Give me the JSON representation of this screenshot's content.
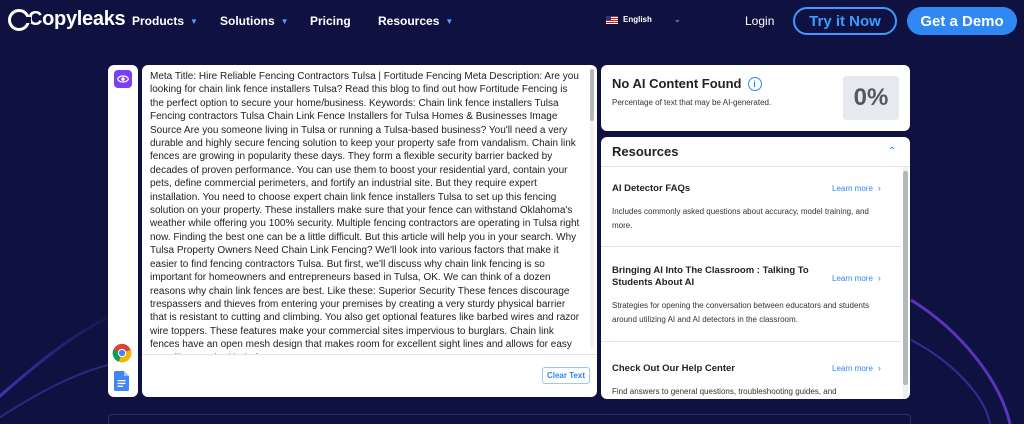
{
  "nav": {
    "logo": "Copyleaks",
    "items": [
      {
        "label": "Products",
        "has_caret": true
      },
      {
        "label": "Solutions",
        "has_caret": true
      },
      {
        "label": "Pricing",
        "has_caret": false
      },
      {
        "label": "Resources",
        "has_caret": true
      }
    ],
    "language": "English",
    "login": "Login",
    "try_label": "Try it Now",
    "demo_label": "Get a Demo"
  },
  "colors": {
    "background": "#0f1240",
    "accent": "#2f87f3",
    "purple": "#7a3ff2"
  },
  "strip": {
    "top_icon": "eye-icon",
    "bottom_icons": [
      "chrome-icon",
      "google-docs-icon"
    ]
  },
  "editor": {
    "text": "Meta Title: Hire Reliable Fencing Contractors Tulsa | Fortitude Fencing Meta Description: Are you looking for chain link fence installers Tulsa? Read this blog to find out how Fortitude Fencing is the perfect option to secure your home/business. Keywords: Chain link fence installers Tulsa Fencing contractors Tulsa Chain Link Fence Installers for Tulsa Homes & Businesses Image Source Are you someone living in Tulsa or running a Tulsa-based business? You'll need a very durable and highly secure fencing solution to keep your property safe from vandalism. Chain link fences are growing in popularity these days. They form a flexible security barrier backed by decades of proven performance. You can use them to boost your residential yard, contain your pets, define commercial perimeters, and fortify an industrial site. But they require expert installation. You need to choose expert chain link fence installers Tulsa to set up this fencing solution on your property. These installers make sure that your fence can withstand Oklahoma's weather while offering you 100% security. Multiple fencing contractors are operating in Tulsa right now. Finding the best one can be a little difficult. But this article will help you in your search. Why Tulsa Property Owners Need Chain Link Fencing? We'll look into various factors that make it easier to find fencing contractors Tulsa. But first, we'll discuss why chain link fencing is so important for homeowners and entrepreneurs based in Tulsa, OK. We can think of a dozen reasons why chain link fences are best. Like these: Superior Security These fences discourage trespassers and thieves from entering your premises by creating a very sturdy physical barrier that is resistant to cutting and climbing. You also get optional features like barbed wires and razor wire toppers. These features make your commercial sites impervious to burglars. Chain link fences have an open mesh design that makes room for excellent sight lines and allows for easy surveillance. The kind of",
    "clear_label": "Clear Text"
  },
  "result": {
    "title": "No AI Content Found",
    "subtitle": "Percentage of text that may be AI-generated.",
    "percent": "0%"
  },
  "resources": {
    "heading": "Resources",
    "items": [
      {
        "title": "AI Detector FAQs",
        "link": "Learn more",
        "desc": "Includes commonly asked questions about accuracy, model training, and more."
      },
      {
        "title": "Bringing AI Into The Classroom : Talking To Students About AI",
        "link": "Learn more",
        "desc": "Strategies for opening the conversation between educators and students around utilizing AI and AI detectors in the classroom."
      },
      {
        "title": "Check Out Our Help Center",
        "link": "Learn more",
        "desc": "Find answers to general questions, troubleshooting guides, and"
      }
    ]
  }
}
